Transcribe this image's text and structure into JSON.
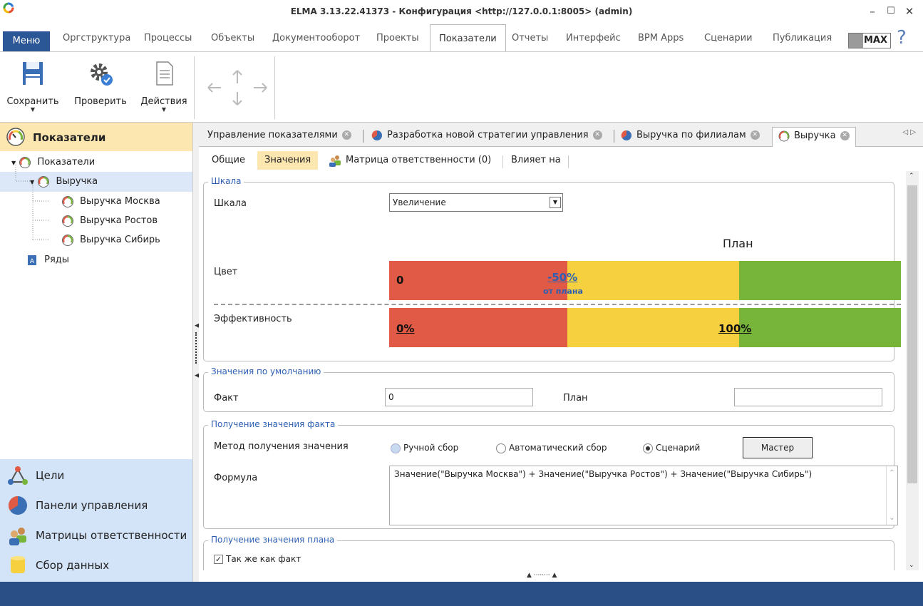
{
  "window": {
    "title": "ELMA 3.13.22.41373 - Конфигурация <http://127.0.0.1:8005> (admin)",
    "minimize": "–",
    "maximize": "☐",
    "close": "✕"
  },
  "menu": {
    "menu_label": "Меню",
    "tabs": [
      "Оргструктура",
      "Процессы",
      "Объекты",
      "Документооборот",
      "Проекты",
      "Показатели",
      "Отчеты",
      "Интерфейс",
      "BPM Apps",
      "Сценарии",
      "Публикация"
    ],
    "active_tab": "Показатели",
    "max_label": "MAX",
    "help": "?"
  },
  "toolbar": {
    "save": "Сохранить",
    "check": "Проверить",
    "actions": "Действия"
  },
  "left_panel": {
    "header": "Показатели",
    "tree": [
      "Показатели",
      "Выручка",
      "Выручка Москва",
      "Выручка Ростов",
      "Выручка Сибирь",
      "Ряды"
    ],
    "bottom": [
      "Цели",
      "Панели управления",
      "Матрицы ответственности",
      "Сбор данных"
    ]
  },
  "doc_tabs": [
    "Управление показателями",
    "Разработка новой стратегии управления",
    "Выручка по филиалам",
    "Выручка"
  ],
  "sub_tabs": [
    "Общие",
    "Значения",
    "Матрица ответственности (0)",
    "Влияет на"
  ],
  "scale_group": {
    "title": "Шкала",
    "scale_label": "Шкала",
    "scale_value": "Увеличение",
    "plan_label": "План",
    "color_label": "Цвет",
    "eff_label": "Эффективность",
    "color_zero": "0",
    "color_mid": "-50%",
    "color_mid_sub": "от плана",
    "eff_zero": "0%",
    "eff_hundred": "100%",
    "colors": {
      "red": "#e05a45",
      "yellow": "#f6d03e",
      "green": "#76b43a"
    }
  },
  "defaults_group": {
    "title": "Значения по умолчанию",
    "fact_label": "Факт",
    "fact_value": "0",
    "plan_label": "План",
    "plan_value": ""
  },
  "fact_group": {
    "title": "Получение значения факта",
    "method_label": "Метод получения значения",
    "opt_manual": "Ручной сбор",
    "opt_auto": "Автоматический сбор",
    "opt_script": "Сценарий",
    "master_btn": "Мастер",
    "formula_label": "Формула",
    "formula_value": "Значение(\"Выручка Москва\")  + Значение(\"Выручка Ростов\")  + Значение(\"Выручка Сибирь\")"
  },
  "plan_group": {
    "title": "Получение значения плана",
    "same_as_fact": "Так же как факт"
  }
}
